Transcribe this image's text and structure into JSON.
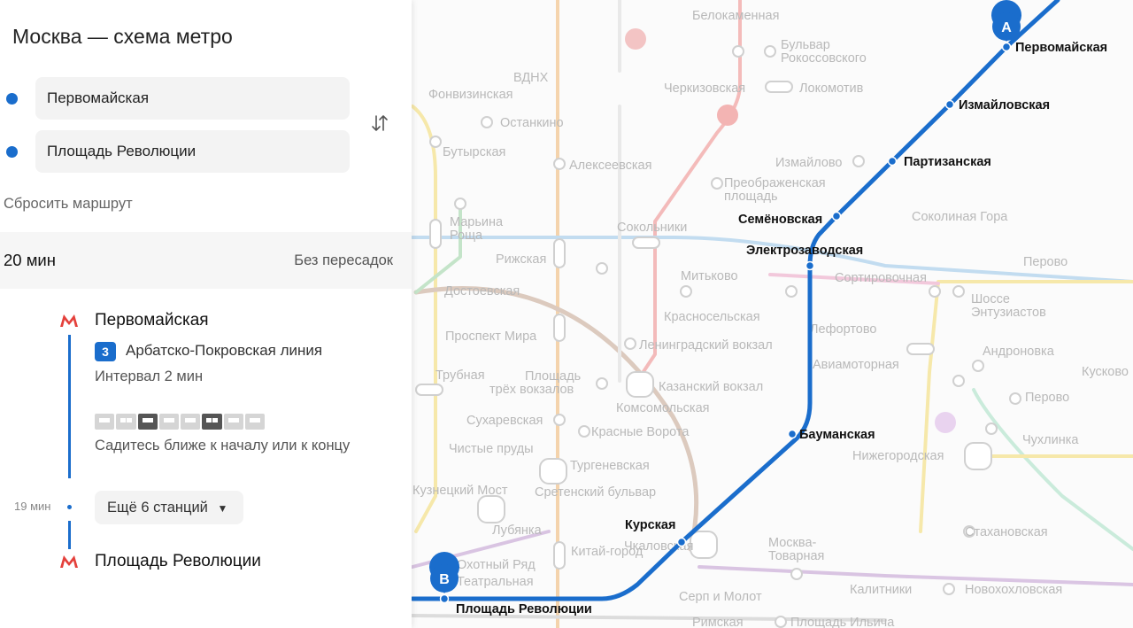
{
  "panel": {
    "title": "Москва — схема метро",
    "from": "Первомайская",
    "to": "Площадь Революции",
    "swap_icon": "swap-arrows-icon",
    "reset": "Сбросить маршрут",
    "summary": {
      "time": "20 мин",
      "transfers": "Без пересадок"
    },
    "route": {
      "start_station": "Первомайская",
      "line_number": "3",
      "line_name": "Арбатско-Покровская линия",
      "line_color": "#1a6dcc",
      "interval": "Интервал 2 мин",
      "train_hint": "Садитесь ближе к началу или к концу",
      "duration": "19 мин",
      "more_stations": "Ещё 6 станций",
      "end_station": "Площадь Революции",
      "metro_icon_color": "#e4403b"
    }
  },
  "map": {
    "marker_a": "A",
    "marker_b": "B",
    "route_color": "#1a6dcc",
    "route_stations": [
      "Первомайская",
      "Измайловская",
      "Партизанская",
      "Семёновская",
      "Электрозаводская",
      "Бауманская",
      "Курская",
      "Площадь Революции"
    ],
    "background_labels": [
      "Белокаменная",
      "Бульвар",
      "Рокоссовского",
      "ВДНХ",
      "Черкизовская",
      "Локомотив",
      "Фонвизинская",
      "Останкино",
      "Бутырская",
      "Алексеевская",
      "Измайлово",
      "Преображенская",
      "площадь",
      "Марьина",
      "Роща",
      "Соколиная Гора",
      "Сокольники",
      "Рижская",
      "Перово",
      "Митьково",
      "Сортировочная",
      "Достоевская",
      "Шоссе",
      "Энтузиастов",
      "Красносельская",
      "Проспект Мира",
      "Лефортово",
      "Ленинградский вокзал",
      "Андроновка",
      "Авиамоторная",
      "Трубная",
      "Площадь",
      "трёх вокзалов",
      "Казанский вокзал",
      "Кусково",
      "Комсомольская",
      "Перово",
      "Сухаревская",
      "Красные Ворота",
      "Чухлинка",
      "Нижегородская",
      "Чистые пруды",
      "Тургеневская",
      "Кузнецкий Мост",
      "Сретенский бульвар",
      "Лубянка",
      "Стахановская",
      "Москва-",
      "Товарная",
      "Охотный Ряд",
      "Китай-город",
      "Театральная",
      "Чкаловская",
      "Калитники",
      "Новохохловская",
      "Серп и Молот",
      "Римская",
      "Площадь Ильича"
    ],
    "line_colors": {
      "red": "#f3b4b3",
      "brown": "#d9c5b8",
      "orange": "#f4cfa4",
      "yellow": "#f6e7a2",
      "green": "#bfe2c4",
      "lightblue": "#bcd9ef",
      "purple": "#d6bfe0",
      "mint": "#c5ead8",
      "pink": "#f2c3d8"
    }
  }
}
